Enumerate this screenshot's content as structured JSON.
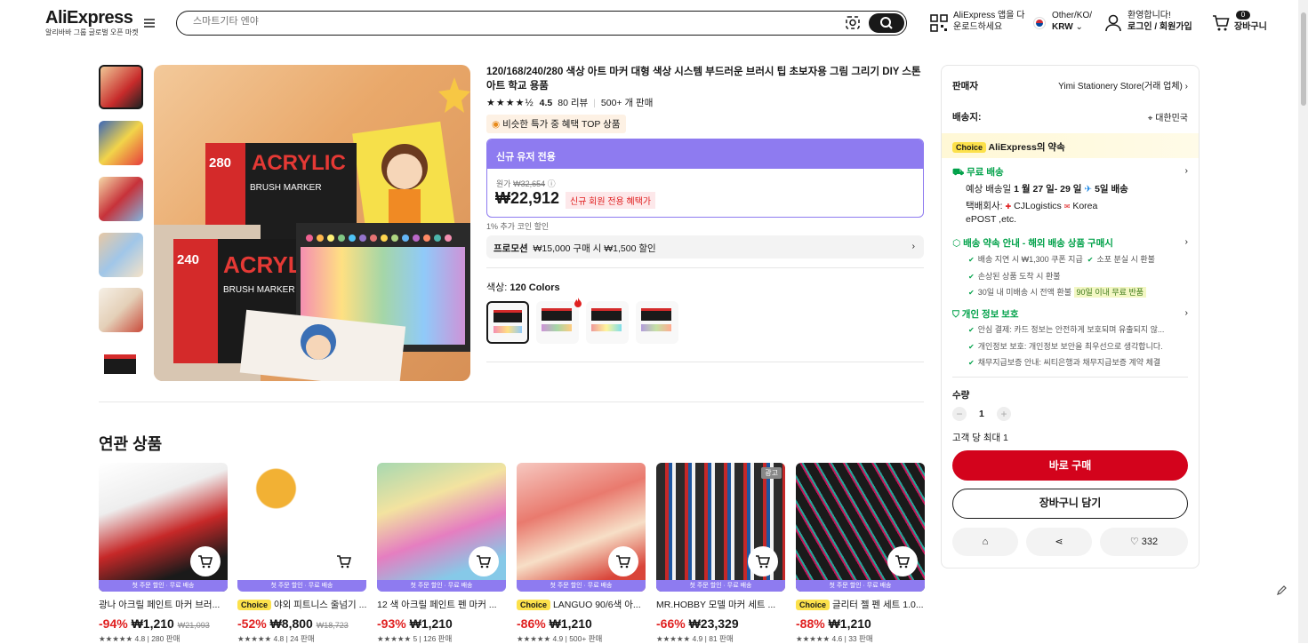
{
  "header": {
    "logo": "AliExpress",
    "logo_sub": "알리바바 그룹 글로벌 오픈 마켓",
    "search_placeholder": "스마트기타 엔야",
    "app_line1": "AliExpress 앱을 다",
    "app_line2": "운로드하세요",
    "lang_line1": "Other/KO/",
    "lang_line2": "KRW",
    "login_line1": "환영합니다!",
    "login_line2": "로그인 / 회원가입",
    "cart_count": "0",
    "cart_label": "장바구니"
  },
  "product": {
    "title": "120/168/240/280 색상 아트 마커 대형 색상 시스템 부드러운 브러시 팁 초보자용 그림 그리기 DIY 스톤 아트 학교 용품",
    "rating": "4.5",
    "reviews": "80 리뷰",
    "sold": "500+ 개 판매",
    "top_badge": "비슷한 특가 중 혜택 TOP 상품",
    "new_user_label": "신규 유저 전용",
    "orig_label": "원가",
    "orig_price": "₩32,654",
    "price": "₩22,912",
    "new_member_tag": "신규 회원 전용 혜택가",
    "coin_note": "1% 추가 코인 할인",
    "promo_label": "프로모션",
    "promo_text": "₩15,000 구매 시 ₩1,500 할인",
    "color_label": "색상:",
    "color_value": "120 Colors",
    "image_text": {
      "box1_count": "280",
      "box1_brand": "ACRYLIC",
      "box1_type": "BRUSH MARKER",
      "box2_count": "240",
      "box2_brand": "ACRYLIC",
      "box2_type": "BRUSH MARKER"
    }
  },
  "panel": {
    "seller_label": "판매자",
    "seller_name": "Yimi Stationery Store(거래 업체)",
    "ship_to_label": "배송지:",
    "ship_to": "대한민국",
    "choice_tag": "Choice",
    "promise_title": "AliExpress의 약속",
    "free_ship": "무료 배송",
    "delivery_prefix": "예상 배송일",
    "delivery_dates": "1 월 27 일- 29 일",
    "delivery_fast": "5일 배송",
    "carrier_label": "택배회사:",
    "carrier1": "CJLogistics",
    "carrier2": "Korea",
    "carrier3": "ePOST ,etc.",
    "promise2_title": "배송 약속 안내 - 해외 배송 상품 구매시",
    "p2_item1": "배송 지연 시 ₩1,300 쿠폰 지급",
    "p2_item2": "소포 분실 시 환불",
    "p2_item3": "손상된 상품 도착 시 환불",
    "p2_item4": "30일 내 미배송 시 전액 환불",
    "p2_badge": "90일 이내 무료 반품",
    "privacy_title": "개인 정보 보호",
    "pv_item1": "안심 결제: 카드 정보는 안전하게 보호되며 유출되지 않...",
    "pv_item2": "개인정보 보호: 개인정보 보안을 최우선으로 생각합니다.",
    "pv_item3": "채무지급보증 안내: 씨티은행과 채무지급보증 계약 체결",
    "qty_label": "수량",
    "qty": "1",
    "qty_limit": "고객 당 최대 1",
    "buy_now": "바로 구매",
    "add_cart": "장바구니 담기",
    "wish_count": "332"
  },
  "related": {
    "title": "연관 상품",
    "strip": "첫 주문 할인 · 무료 배송",
    "ad": "광고",
    "items": [
      {
        "name": "광나 아크릴 페인트 마커 브러...",
        "choice": "",
        "pct": "-94%",
        "price": "₩1,210",
        "old": "₩21,093",
        "meta": "★★★★★ 4.8 | 280 판매"
      },
      {
        "name": "야외 피트니스 줄넘기 ...",
        "choice": "Choice",
        "pct": "-52%",
        "price": "₩8,800",
        "old": "₩18,723",
        "meta": "★★★★★ 4.8 | 24 판매"
      },
      {
        "name": "12 색 아크릴 페인트 펜 마커 ...",
        "choice": "",
        "pct": "-93%",
        "price": "₩1,210",
        "old": "",
        "meta": "★★★★★ 5 | 126 판매"
      },
      {
        "name": "LANGUO 90/6색 아...",
        "choice": "Choice",
        "pct": "-86%",
        "price": "₩1,210",
        "old": "",
        "meta": "★★★★★ 4.9 | 500+ 판매"
      },
      {
        "name": "MR.HOBBY 모델 마커 세트 ...",
        "choice": "",
        "pct": "-66%",
        "price": "₩23,329",
        "old": "",
        "meta": "★★★★★ 4.9 | 81 판매"
      },
      {
        "name": "글리터 젤 펜 세트 1.0...",
        "choice": "Choice",
        "pct": "-88%",
        "price": "₩1,210",
        "old": "",
        "meta": "★★★★★ 4.6 | 33 판매"
      }
    ]
  }
}
